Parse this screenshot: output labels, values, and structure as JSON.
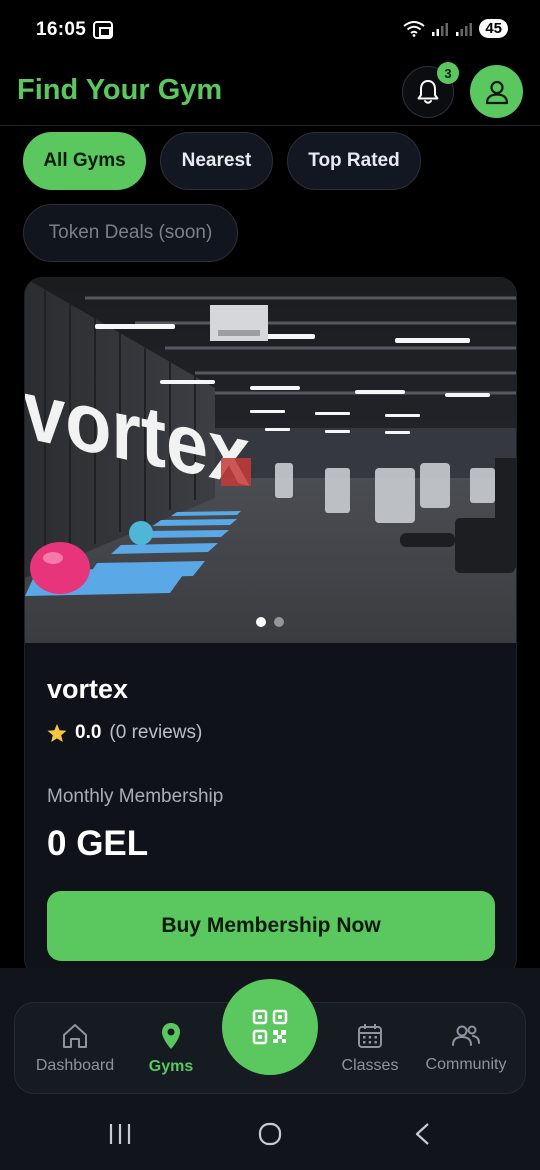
{
  "status_bar": {
    "time": "16:05",
    "battery": "45"
  },
  "header": {
    "title": "Find Your Gym",
    "notification_count": "3"
  },
  "filters": [
    {
      "label": "All Gyms",
      "active": true
    },
    {
      "label": "Nearest",
      "active": false
    },
    {
      "label": "Top Rated",
      "active": false
    },
    {
      "label": "Token Deals (soon)",
      "active": false,
      "disabled": true
    }
  ],
  "gym_card": {
    "name": "vortex",
    "photo_wall_text": "vortex",
    "rating_value": "0.0",
    "rating_count": "(0 reviews)",
    "membership_label": "Monthly Membership",
    "price": "0 GEL",
    "buy_label": "Buy Membership Now",
    "carousel_pages": 2,
    "carousel_active": 1
  },
  "bottom_nav": {
    "items": [
      {
        "label": "Dashboard",
        "icon": "home-icon",
        "active": false
      },
      {
        "label": "Gyms",
        "icon": "map-pin-icon",
        "active": true
      },
      {
        "label": "Classes",
        "icon": "calendar-icon",
        "active": false
      },
      {
        "label": "Community",
        "icon": "users-icon",
        "active": false
      }
    ],
    "center_icon": "qr-code-icon"
  },
  "colors": {
    "accent": "#5ac85f",
    "background": "#000000",
    "card": "#0f1319"
  }
}
